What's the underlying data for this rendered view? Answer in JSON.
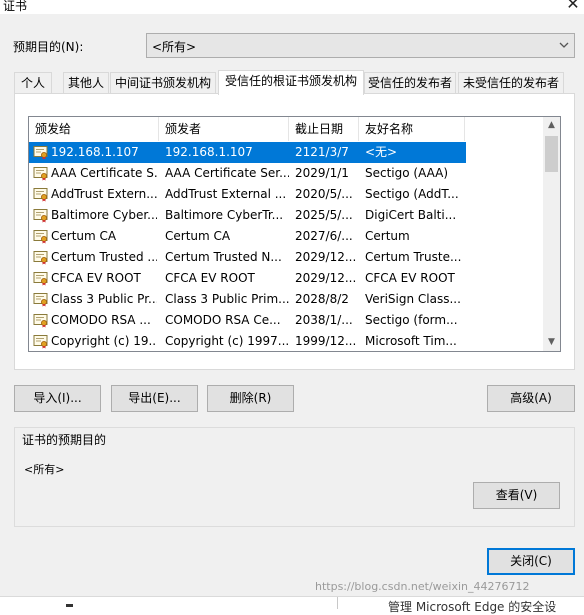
{
  "window": {
    "title": "证书",
    "close_glyph": "✕"
  },
  "purpose": {
    "label": "预期目的(N):",
    "value": "<所有>"
  },
  "tabs": [
    {
      "label": "个人"
    },
    {
      "label": "其他人"
    },
    {
      "label": "中间证书颁发机构"
    },
    {
      "label": "受信任的根证书颁发机构"
    },
    {
      "label": "受信任的发布者"
    },
    {
      "label": "未受信任的发布者"
    }
  ],
  "active_tab": "受信任的根证书颁发机构",
  "table": {
    "columns": [
      "颁发给",
      "颁发者",
      "截止日期",
      "友好名称"
    ],
    "rows": [
      {
        "issued_to": "192.168.1.107",
        "issued_by": "192.168.1.107",
        "expires": "2121/3/7",
        "friendly": "<无>",
        "selected": true
      },
      {
        "issued_to": "AAA Certificate S...",
        "issued_by": "AAA Certificate Ser...",
        "expires": "2029/1/1",
        "friendly": "Sectigo (AAA)"
      },
      {
        "issued_to": "AddTrust Extern...",
        "issued_by": "AddTrust External ...",
        "expires": "2020/5/...",
        "friendly": "Sectigo (AddT..."
      },
      {
        "issued_to": "Baltimore Cyber...",
        "issued_by": "Baltimore CyberTr...",
        "expires": "2025/5/...",
        "friendly": "DigiCert Balti..."
      },
      {
        "issued_to": "Certum CA",
        "issued_by": "Certum CA",
        "expires": "2027/6/...",
        "friendly": "Certum"
      },
      {
        "issued_to": "Certum Trusted ...",
        "issued_by": "Certum Trusted N...",
        "expires": "2029/12...",
        "friendly": "Certum Truste..."
      },
      {
        "issued_to": "CFCA EV ROOT",
        "issued_by": "CFCA EV ROOT",
        "expires": "2029/12...",
        "friendly": "CFCA EV ROOT"
      },
      {
        "issued_to": "Class 3 Public Pr...",
        "issued_by": "Class 3 Public Prim...",
        "expires": "2028/8/2",
        "friendly": "VeriSign Class..."
      },
      {
        "issued_to": "COMODO RSA ...",
        "issued_by": "COMODO RSA Ce...",
        "expires": "2038/1/...",
        "friendly": "Sectigo (form..."
      },
      {
        "issued_to": "Copyright (c) 19...",
        "issued_by": "Copyright (c) 1997...",
        "expires": "1999/12...",
        "friendly": "Microsoft Tim..."
      }
    ]
  },
  "buttons": {
    "import": "导入(I)...",
    "export": "导出(E)...",
    "remove": "删除(R)",
    "advanced": "高级(A)",
    "view": "查看(V)",
    "close": "关闭(C)"
  },
  "purposes_group": {
    "title": "证书的预期目的",
    "value": "<所有>"
  },
  "watermark": "https://blog.csdn.net/weixin_44276712",
  "background_text": "管理 Microsoft Edge 的安全设",
  "colors": {
    "selection": "#0078d7",
    "dialog_bg": "#f0f0f0",
    "button_bg": "#e1e1e1"
  }
}
